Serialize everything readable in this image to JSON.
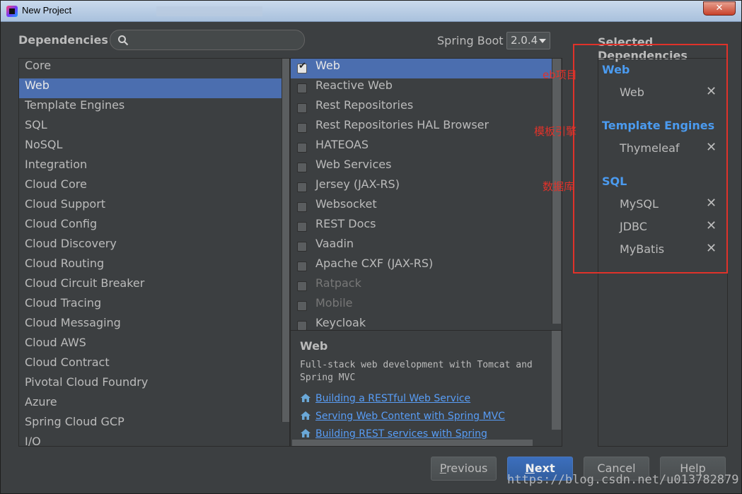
{
  "window": {
    "title": "New Project",
    "close_glyph": "✕"
  },
  "header": {
    "dependencies_label": "Dependencies",
    "search_placeholder": "",
    "spring_boot_label": "Spring Boot",
    "spring_boot_version": "2.0.4",
    "selected_label": "Selected Dependencies"
  },
  "categories": [
    "Core",
    "Web",
    "Template Engines",
    "SQL",
    "NoSQL",
    "Integration",
    "Cloud Core",
    "Cloud Support",
    "Cloud Config",
    "Cloud Discovery",
    "Cloud Routing",
    "Cloud Circuit Breaker",
    "Cloud Tracing",
    "Cloud Messaging",
    "Cloud AWS",
    "Cloud Contract",
    "Pivotal Cloud Foundry",
    "Azure",
    "Spring Cloud GCP",
    "I/O"
  ],
  "selected_category": "Web",
  "dependencies": [
    {
      "label": "Web",
      "checked": true,
      "disabled": false
    },
    {
      "label": "Reactive Web",
      "checked": false,
      "disabled": false
    },
    {
      "label": "Rest Repositories",
      "checked": false,
      "disabled": false
    },
    {
      "label": "Rest Repositories HAL Browser",
      "checked": false,
      "disabled": false
    },
    {
      "label": "HATEOAS",
      "checked": false,
      "disabled": false
    },
    {
      "label": "Web Services",
      "checked": false,
      "disabled": false
    },
    {
      "label": "Jersey (JAX-RS)",
      "checked": false,
      "disabled": false
    },
    {
      "label": "Websocket",
      "checked": false,
      "disabled": false
    },
    {
      "label": "REST Docs",
      "checked": false,
      "disabled": false
    },
    {
      "label": "Vaadin",
      "checked": false,
      "disabled": false
    },
    {
      "label": "Apache CXF (JAX-RS)",
      "checked": false,
      "disabled": false
    },
    {
      "label": "Ratpack",
      "checked": false,
      "disabled": true
    },
    {
      "label": "Mobile",
      "checked": false,
      "disabled": true
    },
    {
      "label": "Keycloak",
      "checked": false,
      "disabled": false
    }
  ],
  "description": {
    "title": "Web",
    "text": "Full-stack web development with Tomcat and Spring MVC",
    "guides": [
      "Building a RESTful Web Service",
      "Serving Web Content with Spring MVC",
      "Building REST services with Spring"
    ]
  },
  "selected": [
    {
      "group": "Web",
      "items": [
        "Web"
      ]
    },
    {
      "group": "Template Engines",
      "items": [
        "Thymeleaf"
      ]
    },
    {
      "group": "SQL",
      "items": [
        "MySQL",
        "JDBC",
        "MyBatis"
      ]
    }
  ],
  "remove_glyph": "✕",
  "annotations": {
    "web": "eb项目",
    "template": "模板引擎",
    "sql": "数据库"
  },
  "buttons": {
    "previous_mnemonic": "P",
    "previous_rest": "revious",
    "next_mnemonic": "N",
    "next_rest": "ext",
    "cancel": "Cancel",
    "help": "Help"
  },
  "watermark": "https://blog.csdn.net/u013782879",
  "colors": {
    "selection": "#4b6eaf",
    "group_header": "#4b9bf0",
    "annotation": "#e0322a",
    "link": "#589df6"
  }
}
